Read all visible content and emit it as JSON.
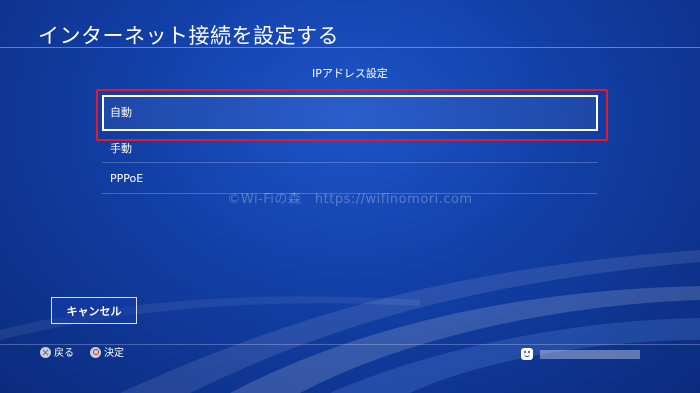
{
  "header": {
    "title": "インターネット接続を設定する"
  },
  "section": {
    "label": "IPアドレス設定"
  },
  "menu": {
    "items": [
      {
        "label": "自動",
        "selected": true
      },
      {
        "label": "手動",
        "selected": false
      },
      {
        "label": "PPPoE",
        "selected": false
      }
    ]
  },
  "watermark": "©Wi-Fiの森　https://wifinomori.com",
  "actions": {
    "cancel_label": "キャンセル"
  },
  "footer": {
    "back_label": "戻る",
    "confirm_label": "決定",
    "back_icon": "cross-button-icon",
    "confirm_icon": "circle-button-icon",
    "user_icon": "smiley-avatar-icon"
  },
  "colors": {
    "background": "#123fa6",
    "highlight": "#e41a2a",
    "text": "#ffffff"
  }
}
